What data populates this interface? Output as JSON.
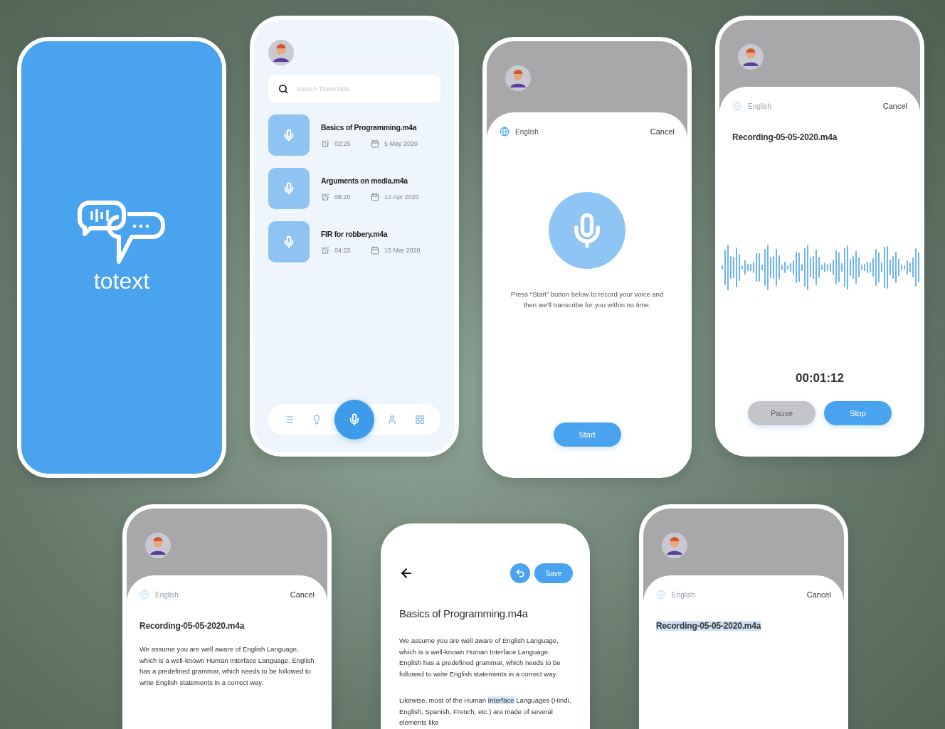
{
  "screens": [
    {
      "kind": "splash",
      "brand": "totext"
    },
    {
      "kind": "list",
      "search": {
        "placeholder": "Search Transcripts"
      },
      "items": [
        {
          "title": "Basics of Programming.m4a",
          "duration": "02:25",
          "date": "5 May 2020"
        },
        {
          "title": "Arguments on media.m4a",
          "duration": "08:20",
          "date": "12 Apr 2020"
        },
        {
          "title": "FIR for robbery.m4a",
          "duration": "04:23",
          "date": "15 Mar 2020"
        }
      ],
      "nav": [
        {
          "selected": false
        },
        {
          "selected": false
        },
        {
          "selected": true
        },
        {
          "selected": false
        },
        {
          "selected": false
        }
      ]
    },
    {
      "kind": "start",
      "language": {
        "label": "English",
        "disabled": false
      },
      "cancel": "Cancel",
      "hint": "Press “Start” button below to record your voice and then we'll transcribe for you within no time.",
      "button": "Start"
    },
    {
      "kind": "recording",
      "language": {
        "label": "English",
        "disabled": true
      },
      "cancel": "Cancel",
      "filename": "Recording-05-05-2020.m4a",
      "timer": "00:01:12",
      "buttons": [
        {
          "label": "Pause",
          "disabled": true
        },
        {
          "label": "Stop",
          "disabled": false
        }
      ]
    },
    {
      "kind": "result",
      "language": {
        "label": "English",
        "disabled": true
      },
      "cancel": "Cancel",
      "filename": "Recording-05-05-2020.m4a",
      "paragraph": "We assume you are well aware of English Language, which is a well-known Human Interface Language. English has a predefined grammar, which needs to be followed to write English statements in a correct way."
    },
    {
      "kind": "editor",
      "save": "Save",
      "title": "Basics of Programming.m4a",
      "paragraphs": [
        [
          {
            "text": "We assume you are well aware of English Language, which is a well-known Human Interface Language. English has a predefined grammar, which needs to be followed to write English statements in a correct way.",
            "highlighted": false
          }
        ],
        [
          {
            "text": "Likewise, most of the Human ",
            "highlighted": false
          },
          {
            "text": "Interface",
            "highlighted": true
          },
          {
            "text": " Languages (Hindi, English, Spanish, French, etc.) are made of several elements like",
            "highlighted": false
          }
        ]
      ]
    },
    {
      "kind": "selecting",
      "language": {
        "label": "English",
        "disabled": true
      },
      "cancel": "Cancel",
      "filename": "Recording-05-05-2020.m4a",
      "filename_selected": true
    }
  ]
}
